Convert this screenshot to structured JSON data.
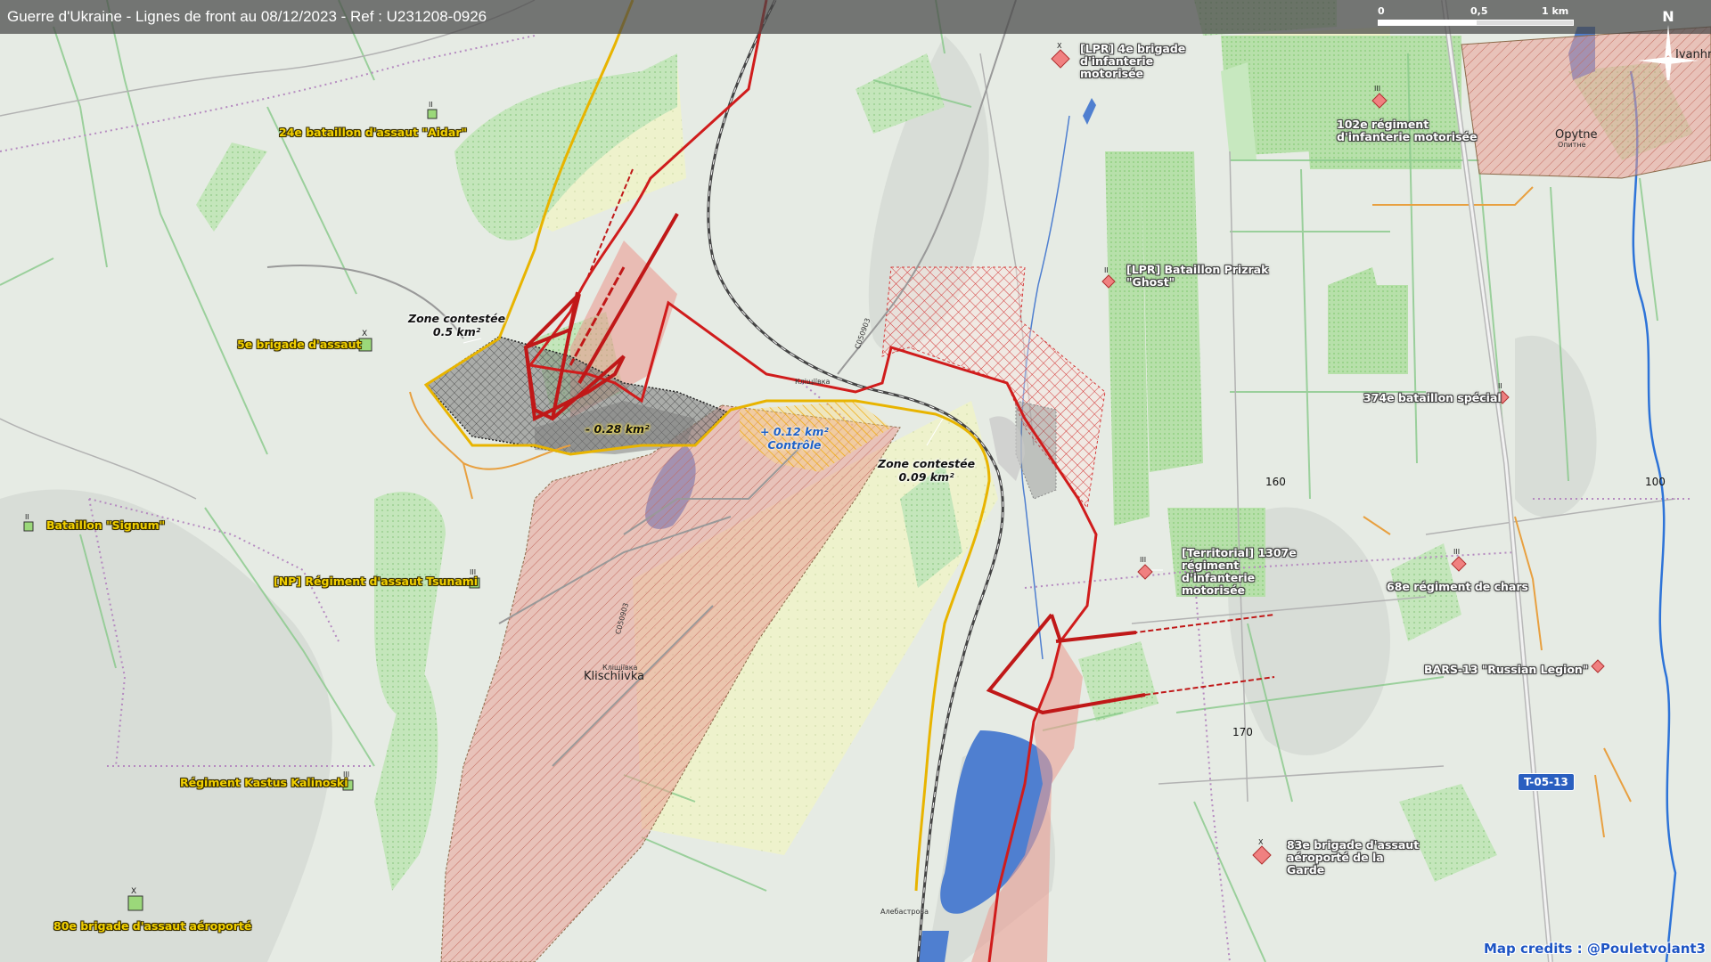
{
  "header": {
    "title": "Guerre d'Ukraine - Lignes de front au 08/12/2023 - Ref : U231208-0926"
  },
  "scale": {
    "zero": "0",
    "half": "0,5",
    "one": "1 km"
  },
  "compass": {
    "north": "N"
  },
  "places": {
    "town_main": "Klischiivka",
    "town_main_cyr": "Кліщіївка",
    "town_top_cyr": "Кліщіївка",
    "opytne": "Opytne",
    "opytne_cyr": "Опитне",
    "ivanhrad": "Ivanhrad",
    "alebastrove": "Алебастрова",
    "road_label_1": "C050903",
    "road_label_2": "C050903"
  },
  "ukraine_units": [
    {
      "id": "aidar",
      "label": "24e bataillon d'assaut \"Aidar\"",
      "echelon": "II"
    },
    {
      "id": "assault5",
      "label": "5e brigade d'assaut",
      "echelon": "X"
    },
    {
      "id": "signum",
      "label": "Bataillon \"Signum\"",
      "echelon": "II"
    },
    {
      "id": "tsunami",
      "label": "[NP] Régiment d'assaut Tsunami",
      "echelon": "III"
    },
    {
      "id": "kalinoski",
      "label": "Régiment Kastus Kalinoski",
      "echelon": "III"
    },
    {
      "id": "airborne80",
      "label": "80e brigade d'assaut aéroporté",
      "echelon": "X"
    }
  ],
  "russia_units": [
    {
      "id": "lpr4",
      "label": "[LPR] 4e brigade d'infanterie motorisée",
      "echelon": "X"
    },
    {
      "id": "r102",
      "label": "102e régiment d'infanterie motorisée",
      "echelon": "III"
    },
    {
      "id": "prizrak",
      "label": "[LPR] Bataillon Prizrak \"Ghost\"",
      "echelon": "II"
    },
    {
      "id": "b374",
      "label": "374e bataillon spécial",
      "echelon": "II"
    },
    {
      "id": "t1307",
      "label": "[Territorial] 1307e régiment d'infanterie motorisée",
      "echelon": "III"
    },
    {
      "id": "tank68",
      "label": "68e régiment de chars",
      "echelon": "III"
    },
    {
      "id": "bars13",
      "label": "BARS-13 \"Russian Legion\"",
      "echelon": "II"
    },
    {
      "id": "air83",
      "label": "83e brigade d'assaut aéroporté de la Garde",
      "echelon": "X"
    }
  ],
  "zones": {
    "contested_1_title": "Zone contestée",
    "contested_1_area": "0.5 km²",
    "contested_2_title": "Zone contestée",
    "contested_2_area": "0.09 km²",
    "loss": "- 0.28 km²",
    "gain_area": "+ 0.12 km²",
    "gain_title": "Contrôle"
  },
  "contours": [
    "160",
    "100",
    "170"
  ],
  "road_shield": "T-05-13",
  "credits": "Map credits : @Pouletvolant3",
  "colors": {
    "front_line": "#d01c1c",
    "ukraine_line": "#e8b400",
    "occupied_fill": "#e9a9a0",
    "water": "#4f7fd0",
    "forest": "#bfe0b8",
    "field": "#eef0c8"
  }
}
